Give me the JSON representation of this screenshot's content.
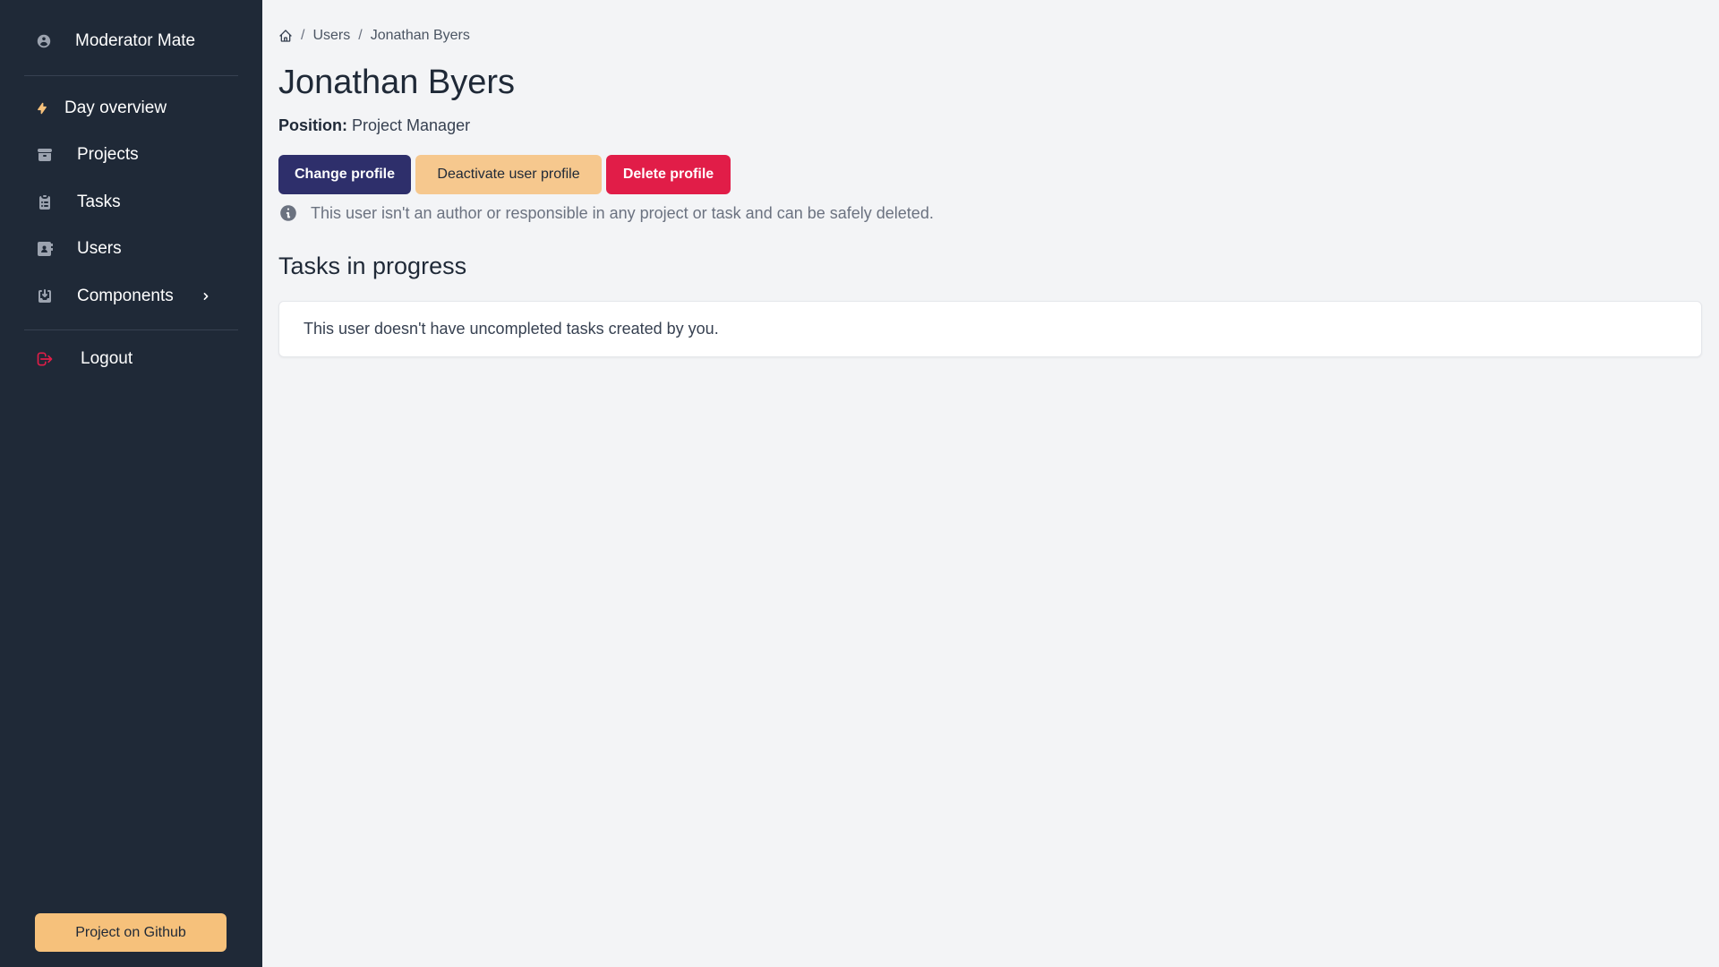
{
  "sidebar": {
    "brand": "Moderator Mate",
    "items": [
      {
        "label": "Day overview",
        "icon": "lightning-icon"
      },
      {
        "label": "Projects",
        "icon": "archive-icon"
      },
      {
        "label": "Tasks",
        "icon": "clipboard-list-icon"
      },
      {
        "label": "Users",
        "icon": "contact-book-icon"
      },
      {
        "label": "Components",
        "icon": "inbox-icon"
      }
    ],
    "logout": "Logout",
    "github": "Project on Github"
  },
  "breadcrumb": {
    "items": [
      "Users",
      "Jonathan Byers"
    ]
  },
  "profile": {
    "name": "Jonathan Byers",
    "position_label": "Position:",
    "position_value": "Project Manager",
    "info": "This user isn't an author or responsible in any project or task and can be safely deleted."
  },
  "actions": {
    "change": "Change profile",
    "deactivate": "Deactivate user profile",
    "delete": "Delete profile"
  },
  "tasks": {
    "title": "Tasks in progress",
    "empty": "This user doesn't have uncompleted tasks created by you."
  },
  "colors": {
    "sidebar_bg": "#1f2937",
    "accent_lightning": "#f6c17b",
    "primary": "#2e2f6b",
    "warning": "#f6c88e",
    "danger": "#e11d48",
    "logout_icon": "#e11d48"
  }
}
